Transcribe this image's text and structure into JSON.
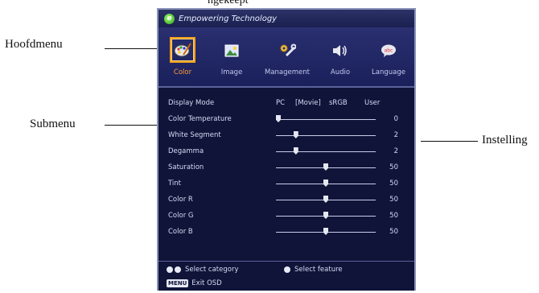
{
  "cut_heading": "ngekeept",
  "callouts": {
    "main_menu": "Hoofdmenu",
    "submenu": "Submenu",
    "settings": "Instelling"
  },
  "osd": {
    "title": "Empowering Technology",
    "logo_glyph": "e",
    "tabs": [
      {
        "label": "Color",
        "icon": "palette-icon",
        "active": true
      },
      {
        "label": "Image",
        "icon": "picture-icon",
        "active": false
      },
      {
        "label": "Management",
        "icon": "tools-icon",
        "active": false
      },
      {
        "label": "Audio",
        "icon": "speaker-icon",
        "active": false
      },
      {
        "label": "Language",
        "icon": "speech-bubble-icon",
        "active": false
      }
    ],
    "display_mode": {
      "label": "Display Mode",
      "options": [
        "PC",
        "[Movie]",
        "sRGB",
        "User"
      ],
      "selected": "Movie"
    },
    "items": [
      {
        "label": "Color Temperature",
        "value": "0",
        "level": 0.0
      },
      {
        "label": "White Segment",
        "value": "2",
        "level": 0.2
      },
      {
        "label": "Degamma",
        "value": "2",
        "level": 0.2
      },
      {
        "label": "Saturation",
        "value": "50",
        "level": 0.5
      },
      {
        "label": "Tint",
        "value": "50",
        "level": 0.5
      },
      {
        "label": "Color R",
        "value": "50",
        "level": 0.5
      },
      {
        "label": "Color G",
        "value": "50",
        "level": 0.5
      },
      {
        "label": "Color B",
        "value": "50",
        "level": 0.5
      }
    ],
    "footer": {
      "select_category": "Select category",
      "select_feature": "Select feature",
      "menu_key": "MENU",
      "exit": "Exit OSD"
    }
  },
  "colors": {
    "accent": "#f7a21b",
    "panel": "#0f1438",
    "active_label": "#ff9a3a"
  }
}
